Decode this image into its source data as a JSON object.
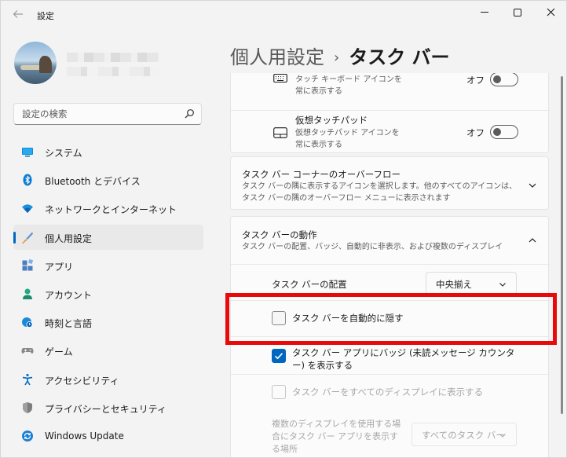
{
  "window": {
    "title": "設定",
    "accent_color": "#0067c0",
    "highlight_color": "#e80a0a"
  },
  "sidebar": {
    "search": {
      "placeholder": "設定の検索"
    },
    "items": [
      {
        "label": "システム",
        "icon": "monitor-icon"
      },
      {
        "label": "Bluetooth とデバイス",
        "icon": "bluetooth-icon"
      },
      {
        "label": "ネットワークとインターネット",
        "icon": "wifi-icon"
      },
      {
        "label": "個人用設定",
        "icon": "brush-icon",
        "active": true
      },
      {
        "label": "アプリ",
        "icon": "apps-icon"
      },
      {
        "label": "アカウント",
        "icon": "person-icon"
      },
      {
        "label": "時刻と言語",
        "icon": "clock-globe-icon"
      },
      {
        "label": "ゲーム",
        "icon": "gamepad-icon"
      },
      {
        "label": "アクセシビリティ",
        "icon": "accessibility-icon"
      },
      {
        "label": "プライバシーとセキュリティ",
        "icon": "shield-icon"
      },
      {
        "label": "Windows Update",
        "icon": "update-icon"
      }
    ]
  },
  "header": {
    "crumb": "個人用設定",
    "separator": "›",
    "current": "タスク バー"
  },
  "content": {
    "touch_keyboard": {
      "desc": "タッチ キーボード アイコンを常に表示する",
      "toggle_label": "オフ"
    },
    "virtual_touchpad": {
      "title": "仮想タッチパッド",
      "desc": "仮想タッチパッド アイコンを常に表示する",
      "toggle_label": "オフ"
    },
    "corner_overflow": {
      "title": "タスク バー コーナーのオーバーフロー",
      "desc": "タスク バーの隅に表示するアイコンを選択します。他のすべてのアイコンは、タスク バーの隅のオーバーフロー メニューに表示されます"
    },
    "behaviors": {
      "title": "タスク バーの動作",
      "desc": "タスク バーの配置、バッジ、自動的に非表示、および複数のディスプレイ",
      "alignment_label": "タスク バーの配置",
      "alignment_value": "中央揃え",
      "auto_hide_label": "タスク バーを自動的に隠す",
      "badges_label": "タスク バー アプリにバッジ (未読メッセージ カウンター) を表示する",
      "all_displays_label": "タスク バーをすべてのディスプレイに表示する",
      "multi_display_label": "複数のディスプレイを使用する場合にタスク バー アプリを表示する場所",
      "multi_display_value": "すべてのタスク バー"
    }
  }
}
